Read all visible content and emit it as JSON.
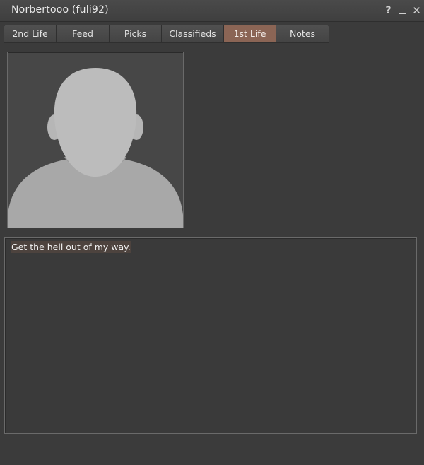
{
  "window": {
    "title": "Norbertooo (fuli92)",
    "controls": [
      {
        "name": "help",
        "icon": "question-mark-icon",
        "glyph": "?"
      },
      {
        "name": "minimize",
        "icon": "minimize-icon"
      },
      {
        "name": "close",
        "icon": "close-icon",
        "glyph": "✕"
      }
    ]
  },
  "tabs": [
    {
      "label": "2nd Life",
      "active": false
    },
    {
      "label": "Feed",
      "active": false
    },
    {
      "label": "Picks",
      "active": false
    },
    {
      "label": "Classifieds",
      "active": false
    },
    {
      "label": "1st Life",
      "active": true
    },
    {
      "label": "Notes",
      "active": false
    }
  ],
  "profile": {
    "image": "default-avatar-silhouette",
    "description": "Get the hell out of my way."
  },
  "colors": {
    "background": "#3b3b3b",
    "active_tab": "#8b6555",
    "silhouette": "#b4b4b4"
  }
}
